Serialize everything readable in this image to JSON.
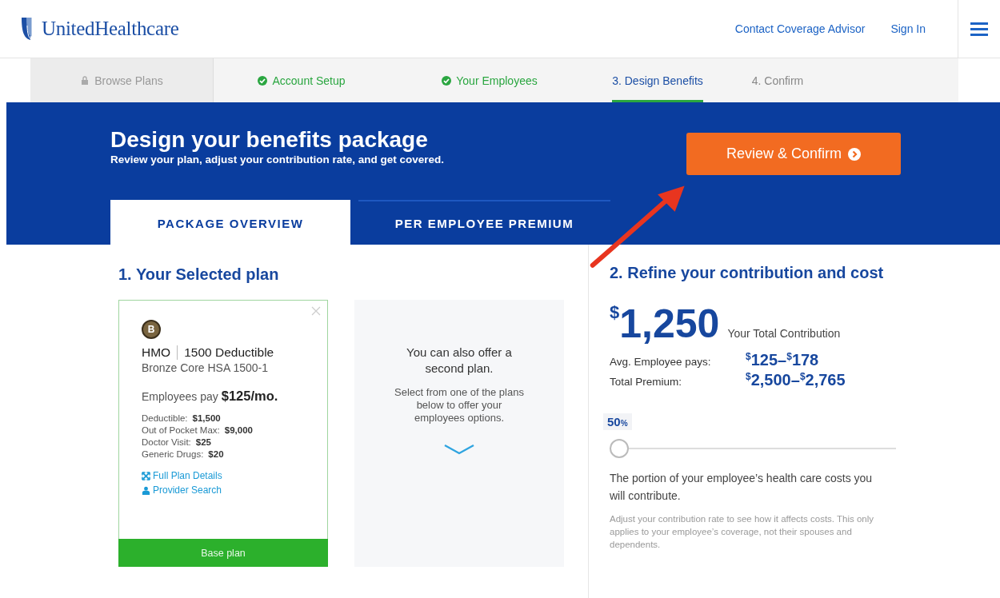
{
  "header": {
    "logo": "UnitedHealthcare",
    "links": [
      "Contact Coverage Advisor",
      "Sign In"
    ]
  },
  "steps": [
    {
      "label": "Browse Plans",
      "kind": "locked",
      "selected": false
    },
    {
      "label": "Account Setup",
      "kind": "done",
      "selected": false
    },
    {
      "label": "Your Employees",
      "kind": "done",
      "selected": false
    },
    {
      "label": "3. Design Benefits",
      "kind": "todo",
      "selected": true
    },
    {
      "label": "4. Confirm",
      "kind": "todo",
      "selected": false
    }
  ],
  "banner": {
    "title": "Design your benefits package",
    "subtitle": "Review your plan, adjust your contribution rate, and get covered.",
    "button": "Review & Confirm"
  },
  "tabs": [
    {
      "label": "PACKAGE OVERVIEW",
      "selected": true
    },
    {
      "label": "PER EMPLOYEE PREMIUM",
      "selected": false
    }
  ],
  "plans": {
    "heading": "1. Your Selected plan",
    "selected_plan": {
      "badge": "B",
      "type": "HMO",
      "name": "1500 Deductible",
      "subtitle": "Bronze Core HSA 1500-1",
      "pay_label": "Employees pay",
      "pay_amount": "$125/mo.",
      "details": [
        {
          "label": "Deductible:",
          "value": "$1,500"
        },
        {
          "label": "Out of Pocket Max:",
          "value": "$9,000"
        },
        {
          "label": "Doctor Visit:",
          "value": "$25"
        },
        {
          "label": "Generic Drugs:",
          "value": "$20"
        }
      ],
      "links": [
        {
          "label": "Full Plan Details",
          "kind": "expand"
        },
        {
          "label": "Provider Search",
          "kind": "person"
        }
      ],
      "footer": "Base plan"
    },
    "second_plan": {
      "title": "You can also offer a second plan.",
      "text": "Select from one of the plans below to offer your employees options."
    }
  },
  "contribution": {
    "heading": "2. Refine your contribution and cost",
    "total": {
      "currency": "$",
      "amount": "1,250",
      "label": "Your Total Contribution"
    },
    "rows": [
      {
        "label": "Avg. Employee pays:",
        "low": {
          "currency": "$",
          "amount": "125"
        },
        "sep": "–",
        "high": {
          "currency": "$",
          "amount": "178"
        }
      },
      {
        "label": "Total Premium:",
        "low": {
          "currency": "$",
          "amount": "2,500"
        },
        "sep": "–",
        "high": {
          "currency": "$",
          "amount": "2,765"
        }
      }
    ],
    "slider": {
      "value": "50",
      "unit": "%",
      "level": 0
    },
    "description": "The portion of your employee’s health care costs you will contribute.",
    "note": "Adjust your contribution rate to see how it affects costs. This only applies to your employee’s coverage, not their spouses and dependents."
  }
}
